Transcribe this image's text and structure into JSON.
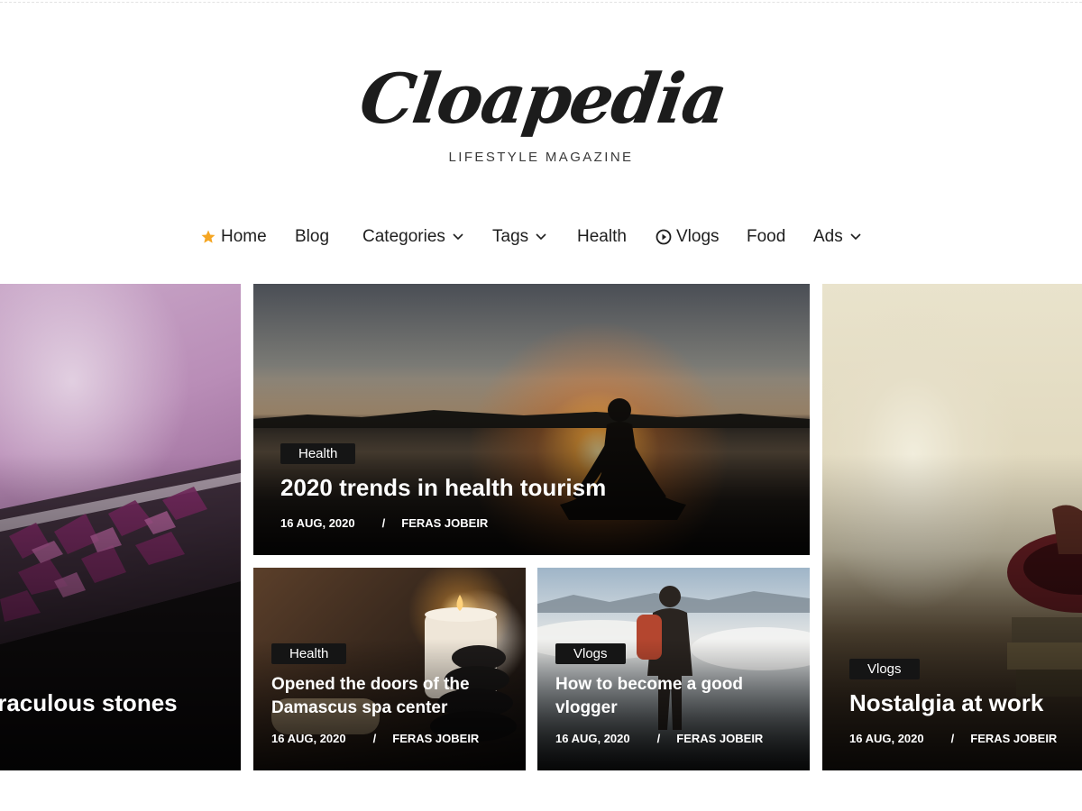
{
  "site": {
    "logo_name": "Cloapedia",
    "logo_tagline": "LIFESTYLE MAGAZINE"
  },
  "nav": {
    "items": [
      {
        "label": "Home",
        "icon": "star-icon",
        "icon_color": "#f5a623"
      },
      {
        "label": "Blog"
      },
      {
        "label": "Categories",
        "has_dropdown": true
      },
      {
        "label": "Tags",
        "has_dropdown": true
      },
      {
        "label": "Health"
      },
      {
        "label": "Vlogs",
        "icon": "play-circle-icon"
      },
      {
        "label": "Food"
      },
      {
        "label": "Ads",
        "has_dropdown": true
      }
    ]
  },
  "posts": [
    {
      "title": "iraculous stones",
      "category": "",
      "date": "",
      "author": ""
    },
    {
      "title": "2020 trends in health tourism",
      "category": "Health",
      "date": "16 AUG, 2020",
      "author": "FERAS JOBEIR"
    },
    {
      "title_line1": "Opened the doors of the",
      "title_line2": "Damascus spa center",
      "category": "Health",
      "date": "16 AUG, 2020",
      "author": "FERAS JOBEIR"
    },
    {
      "title_line1": "How to become a good",
      "title_line2": "vlogger",
      "category": "Vlogs",
      "date": "16 AUG, 2020",
      "author": "FERAS JOBEIR"
    },
    {
      "title": "Nostalgia at work",
      "category": "Vlogs",
      "date": "16 AUG, 2020",
      "author": "FERAS JOBEIR"
    }
  ],
  "meta_separator": "/"
}
